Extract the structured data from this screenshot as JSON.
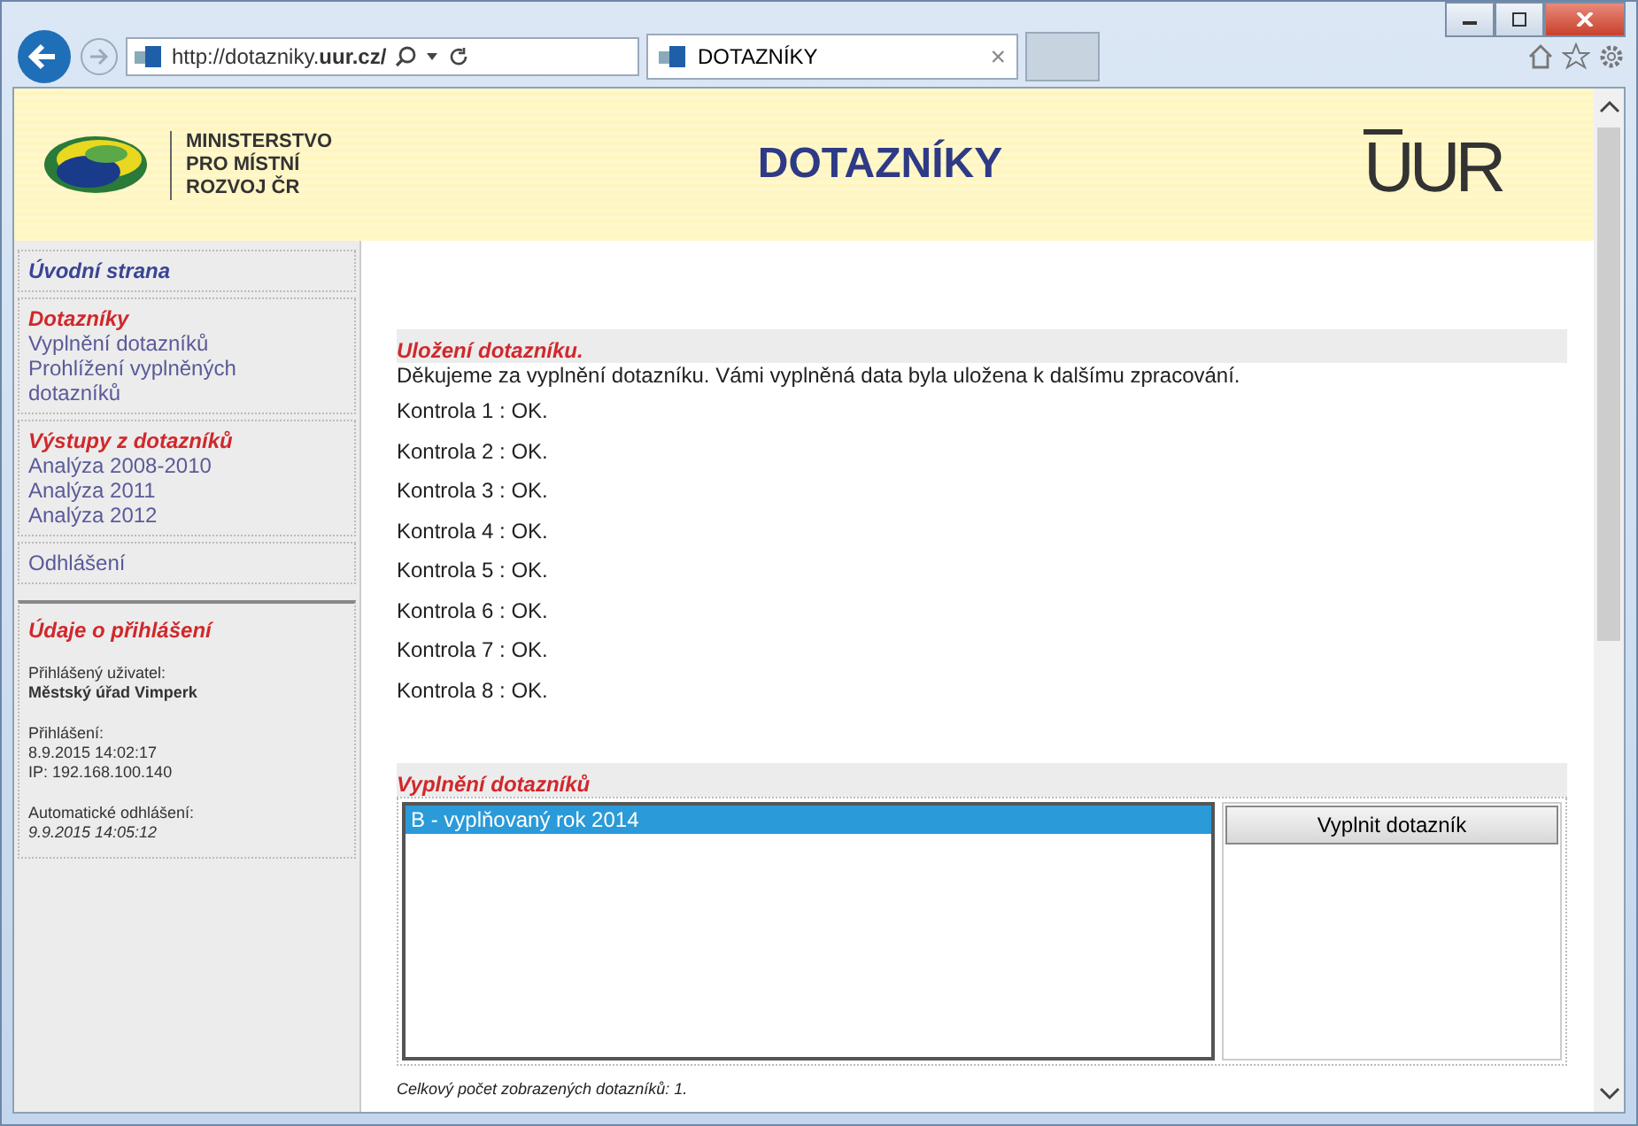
{
  "browser": {
    "address": "http://dotazniky.**uur.cz/**",
    "tab": {
      "title": "DOTAZNÍKY",
      "close": "×"
    }
  },
  "header": {
    "ministry": [
      "MINISTERSTVO",
      "PRO MÍSTNÍ",
      "ROZVOJ ČR"
    ],
    "title": "DOTAZNÍKY",
    "logo": "UUR"
  },
  "sidebar": {
    "groups": [
      {
        "kind": "home",
        "title": "Úvodní strana"
      },
      {
        "kind": "section",
        "title": "Dotazníky",
        "items": [
          "Vyplnění dotazníků",
          "Prohlížení vyplněných dotazníků"
        ]
      },
      {
        "kind": "section",
        "title": "Výstupy z dotazníků",
        "items": [
          "Analýza 2008-2010",
          "Analýza 2011",
          "Analýza 2012"
        ]
      },
      {
        "kind": "link",
        "title": "Odhlášení"
      }
    ],
    "login_info": {
      "title": "Údaje o přihlášení",
      "user_label": "Přihlášený uživatel:",
      "user": "Městský úřad Vimperk",
      "login_label": "Přihlášení:",
      "login_time": "8.9.2015 14:02:17",
      "ip": "IP: 192.168.100.140",
      "auto_label": "Automatické odhlášení:",
      "auto_time": "9.9.2015 14:05:12"
    }
  },
  "save_section": {
    "title": "Uložení dotazníku.",
    "message": "Děkujeme za vyplnění dotazníku. Vámi vyplněná data byla uložena k dalšímu zpracování.",
    "checks": [
      "Kontrola 1 : OK.",
      "Kontrola 2 : OK.",
      "Kontrola 3 : OK.",
      "Kontrola 4 : OK.",
      "Kontrola 5 : OK.",
      "Kontrola 6 : OK.",
      "Kontrola 7 : OK.",
      "Kontrola 8 : OK."
    ]
  },
  "fill_section": {
    "title": "Vyplnění dotazníků",
    "items": [
      {
        "label": "B - vyplňovaný rok 2014",
        "selected": true
      }
    ],
    "button": "Vyplnit dotazník",
    "footer": "Celkový počet zobrazených dotazníků: 1."
  }
}
